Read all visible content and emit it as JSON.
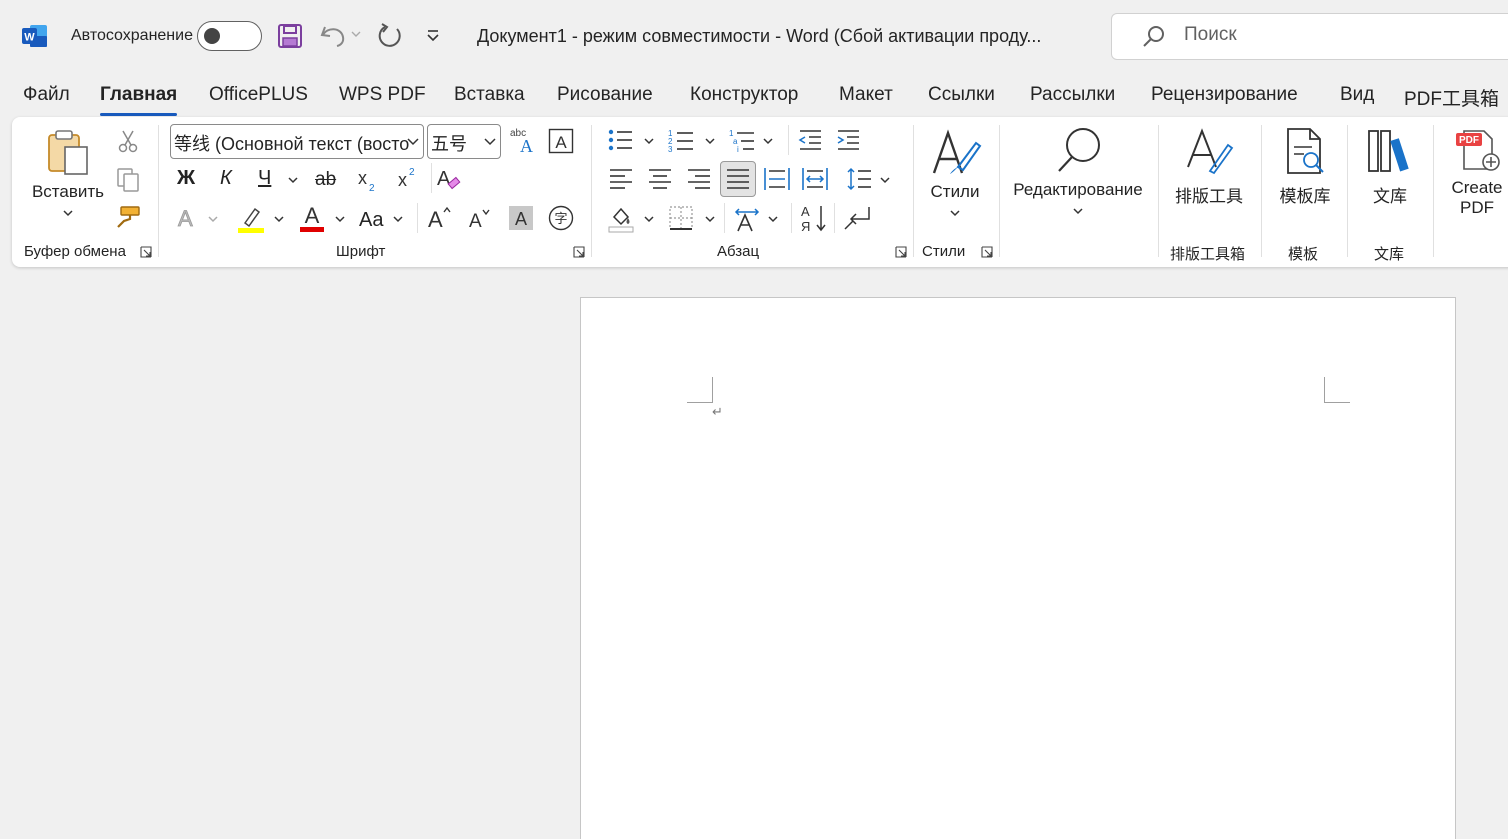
{
  "titlebar": {
    "autosave_label": "Автосохранение",
    "doc_title": "Документ1  -  режим совместимости  -  Word (Сбой активации проду...",
    "search_placeholder": "Поиск"
  },
  "tabs": [
    {
      "label": "Файл"
    },
    {
      "label": "Главная"
    },
    {
      "label": "OfficePLUS"
    },
    {
      "label": "WPS PDF"
    },
    {
      "label": "Вставка"
    },
    {
      "label": "Рисование"
    },
    {
      "label": "Конструктор"
    },
    {
      "label": "Макет"
    },
    {
      "label": "Ссылки"
    },
    {
      "label": "Рассылки"
    },
    {
      "label": "Рецензирование"
    },
    {
      "label": "Вид"
    },
    {
      "label": "PDF工具箱"
    }
  ],
  "ribbon": {
    "clipboard": {
      "paste_label": "Вставить",
      "group_label": "Буфер обмена"
    },
    "font": {
      "font_name": "等线 (Основной текст (восто",
      "font_size": "五号",
      "group_label": "Шрифт",
      "bold": "Ж",
      "italic": "К",
      "underline": "Ч",
      "strike": "ab",
      "case": "Aa"
    },
    "paragraph": {
      "group_label": "Абзац"
    },
    "styles": {
      "label": "Стили",
      "group_label": "Стили"
    },
    "editing": {
      "label": "Редактирование"
    },
    "layout_tool": {
      "label": "排版工具",
      "group_label": "排版工具箱"
    },
    "templates": {
      "label": "模板库",
      "group_label": "模板"
    },
    "library": {
      "label": "文库",
      "group_label": "文库"
    },
    "create_pdf": {
      "line1": "Create",
      "line2": "PDF"
    }
  },
  "colors": {
    "accent": "#185abd",
    "highlight": "#ffff00",
    "font_color": "#e00000"
  }
}
